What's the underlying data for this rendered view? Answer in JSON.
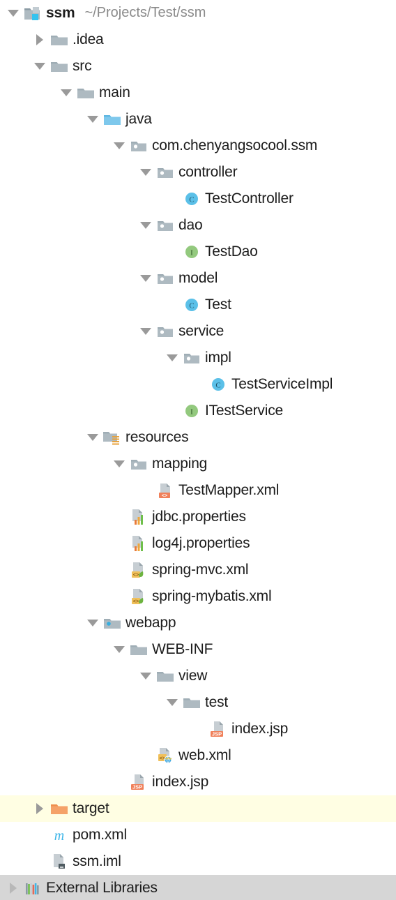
{
  "window": {
    "title": "Project tool window",
    "theme_colors": {
      "background": "#ffffff",
      "text": "#1c1c1c",
      "muted_text": "#8a8a8a",
      "excluded_row": "#fffee3",
      "selected_row": "#d6d6d6",
      "folder_gray": "#aebac1",
      "source_root_blue": "#6fc4e8",
      "class_blue": "#5bc0e8",
      "interface_green": "#93c97e",
      "target_orange": "#f4a261",
      "xml_orange": "#f08a5d"
    }
  },
  "tree": {
    "nodes": [
      {
        "id": "ssm",
        "label": "ssm",
        "path": "~/Projects/Test/ssm",
        "depth": 0,
        "toggle": "down",
        "icon": "project-root-folder-icon",
        "bold": true,
        "row_style": "normal"
      },
      {
        "id": "idea",
        "label": ".idea",
        "path": "",
        "depth": 1,
        "toggle": "right",
        "icon": "folder-icon",
        "bold": false,
        "row_style": "normal"
      },
      {
        "id": "src",
        "label": "src",
        "path": "",
        "depth": 1,
        "toggle": "down",
        "icon": "folder-icon",
        "bold": false,
        "row_style": "normal"
      },
      {
        "id": "main",
        "label": "main",
        "path": "",
        "depth": 2,
        "toggle": "down",
        "icon": "folder-icon",
        "bold": false,
        "row_style": "normal"
      },
      {
        "id": "java",
        "label": "java",
        "path": "",
        "depth": 3,
        "toggle": "down",
        "icon": "source-root-folder-icon",
        "bold": false,
        "row_style": "normal"
      },
      {
        "id": "package-root",
        "label": "com.chenyangsocool.ssm",
        "path": "",
        "depth": 4,
        "toggle": "down",
        "icon": "package-folder-icon",
        "bold": false,
        "row_style": "normal"
      },
      {
        "id": "controller",
        "label": "controller",
        "path": "",
        "depth": 5,
        "toggle": "down",
        "icon": "package-folder-icon",
        "bold": false,
        "row_style": "normal"
      },
      {
        "id": "TestController",
        "label": "TestController",
        "path": "",
        "depth": 6,
        "toggle": "none",
        "icon": "java-class-icon",
        "bold": false,
        "row_style": "normal"
      },
      {
        "id": "dao",
        "label": "dao",
        "path": "",
        "depth": 5,
        "toggle": "down",
        "icon": "package-folder-icon",
        "bold": false,
        "row_style": "normal"
      },
      {
        "id": "TestDao",
        "label": "TestDao",
        "path": "",
        "depth": 6,
        "toggle": "none",
        "icon": "java-interface-icon",
        "bold": false,
        "row_style": "normal"
      },
      {
        "id": "model",
        "label": "model",
        "path": "",
        "depth": 5,
        "toggle": "down",
        "icon": "package-folder-icon",
        "bold": false,
        "row_style": "normal"
      },
      {
        "id": "Test",
        "label": "Test",
        "path": "",
        "depth": 6,
        "toggle": "none",
        "icon": "java-class-icon",
        "bold": false,
        "row_style": "normal"
      },
      {
        "id": "service",
        "label": "service",
        "path": "",
        "depth": 5,
        "toggle": "down",
        "icon": "package-folder-icon",
        "bold": false,
        "row_style": "normal"
      },
      {
        "id": "impl",
        "label": "impl",
        "path": "",
        "depth": 6,
        "toggle": "down",
        "icon": "package-folder-icon",
        "bold": false,
        "row_style": "normal"
      },
      {
        "id": "TestServiceImpl",
        "label": "TestServiceImpl",
        "path": "",
        "depth": 7,
        "toggle": "none",
        "icon": "java-class-icon",
        "bold": false,
        "row_style": "normal"
      },
      {
        "id": "ITestService",
        "label": "ITestService",
        "path": "",
        "depth": 6,
        "toggle": "none",
        "icon": "java-interface-icon",
        "bold": false,
        "row_style": "normal"
      },
      {
        "id": "resources",
        "label": "resources",
        "path": "",
        "depth": 3,
        "toggle": "down",
        "icon": "resource-root-folder-icon",
        "bold": false,
        "row_style": "normal"
      },
      {
        "id": "mapping",
        "label": "mapping",
        "path": "",
        "depth": 4,
        "toggle": "down",
        "icon": "package-folder-icon",
        "bold": false,
        "row_style": "normal"
      },
      {
        "id": "TestMapper.xml",
        "label": "TestMapper.xml",
        "path": "",
        "depth": 5,
        "toggle": "none",
        "icon": "xml-file-icon",
        "bold": false,
        "row_style": "normal"
      },
      {
        "id": "jdbc.properties",
        "label": "jdbc.properties",
        "path": "",
        "depth": 4,
        "toggle": "none",
        "icon": "properties-file-icon",
        "bold": false,
        "row_style": "normal"
      },
      {
        "id": "log4j.properties",
        "label": "log4j.properties",
        "path": "",
        "depth": 4,
        "toggle": "none",
        "icon": "properties-file-icon",
        "bold": false,
        "row_style": "normal"
      },
      {
        "id": "spring-mvc.xml",
        "label": "spring-mvc.xml",
        "path": "",
        "depth": 4,
        "toggle": "none",
        "icon": "spring-xml-file-icon",
        "bold": false,
        "row_style": "normal"
      },
      {
        "id": "spring-mybatis.xml",
        "label": "spring-mybatis.xml",
        "path": "",
        "depth": 4,
        "toggle": "none",
        "icon": "spring-xml-file-icon",
        "bold": false,
        "row_style": "normal"
      },
      {
        "id": "webapp",
        "label": "webapp",
        "path": "",
        "depth": 3,
        "toggle": "down",
        "icon": "web-root-folder-icon",
        "bold": false,
        "row_style": "normal"
      },
      {
        "id": "WEB-INF",
        "label": "WEB-INF",
        "path": "",
        "depth": 4,
        "toggle": "down",
        "icon": "folder-icon",
        "bold": false,
        "row_style": "normal"
      },
      {
        "id": "view",
        "label": "view",
        "path": "",
        "depth": 5,
        "toggle": "down",
        "icon": "folder-icon",
        "bold": false,
        "row_style": "normal"
      },
      {
        "id": "test",
        "label": "test",
        "path": "",
        "depth": 6,
        "toggle": "down",
        "icon": "folder-icon",
        "bold": false,
        "row_style": "normal"
      },
      {
        "id": "view-index.jsp",
        "label": "index.jsp",
        "path": "",
        "depth": 7,
        "toggle": "none",
        "icon": "jsp-file-icon",
        "bold": false,
        "row_style": "normal"
      },
      {
        "id": "web.xml",
        "label": "web.xml",
        "path": "",
        "depth": 5,
        "toggle": "none",
        "icon": "web-xml-file-icon",
        "bold": false,
        "row_style": "normal"
      },
      {
        "id": "root-index.jsp",
        "label": "index.jsp",
        "path": "",
        "depth": 4,
        "toggle": "none",
        "icon": "jsp-file-icon",
        "bold": false,
        "row_style": "normal"
      },
      {
        "id": "target",
        "label": "target",
        "path": "",
        "depth": 1,
        "toggle": "right",
        "icon": "excluded-folder-icon",
        "bold": false,
        "row_style": "excluded"
      },
      {
        "id": "pom.xml",
        "label": "pom.xml",
        "path": "",
        "depth": 1,
        "toggle": "none",
        "icon": "maven-pom-file-icon",
        "bold": false,
        "row_style": "normal"
      },
      {
        "id": "ssm.iml",
        "label": "ssm.iml",
        "path": "",
        "depth": 1,
        "toggle": "none",
        "icon": "iml-module-file-icon",
        "bold": false,
        "row_style": "normal"
      },
      {
        "id": "External Libraries",
        "label": "External Libraries",
        "path": "",
        "depth": 0,
        "toggle": "right-pale",
        "icon": "external-libraries-icon",
        "bold": false,
        "row_style": "selected"
      }
    ]
  }
}
